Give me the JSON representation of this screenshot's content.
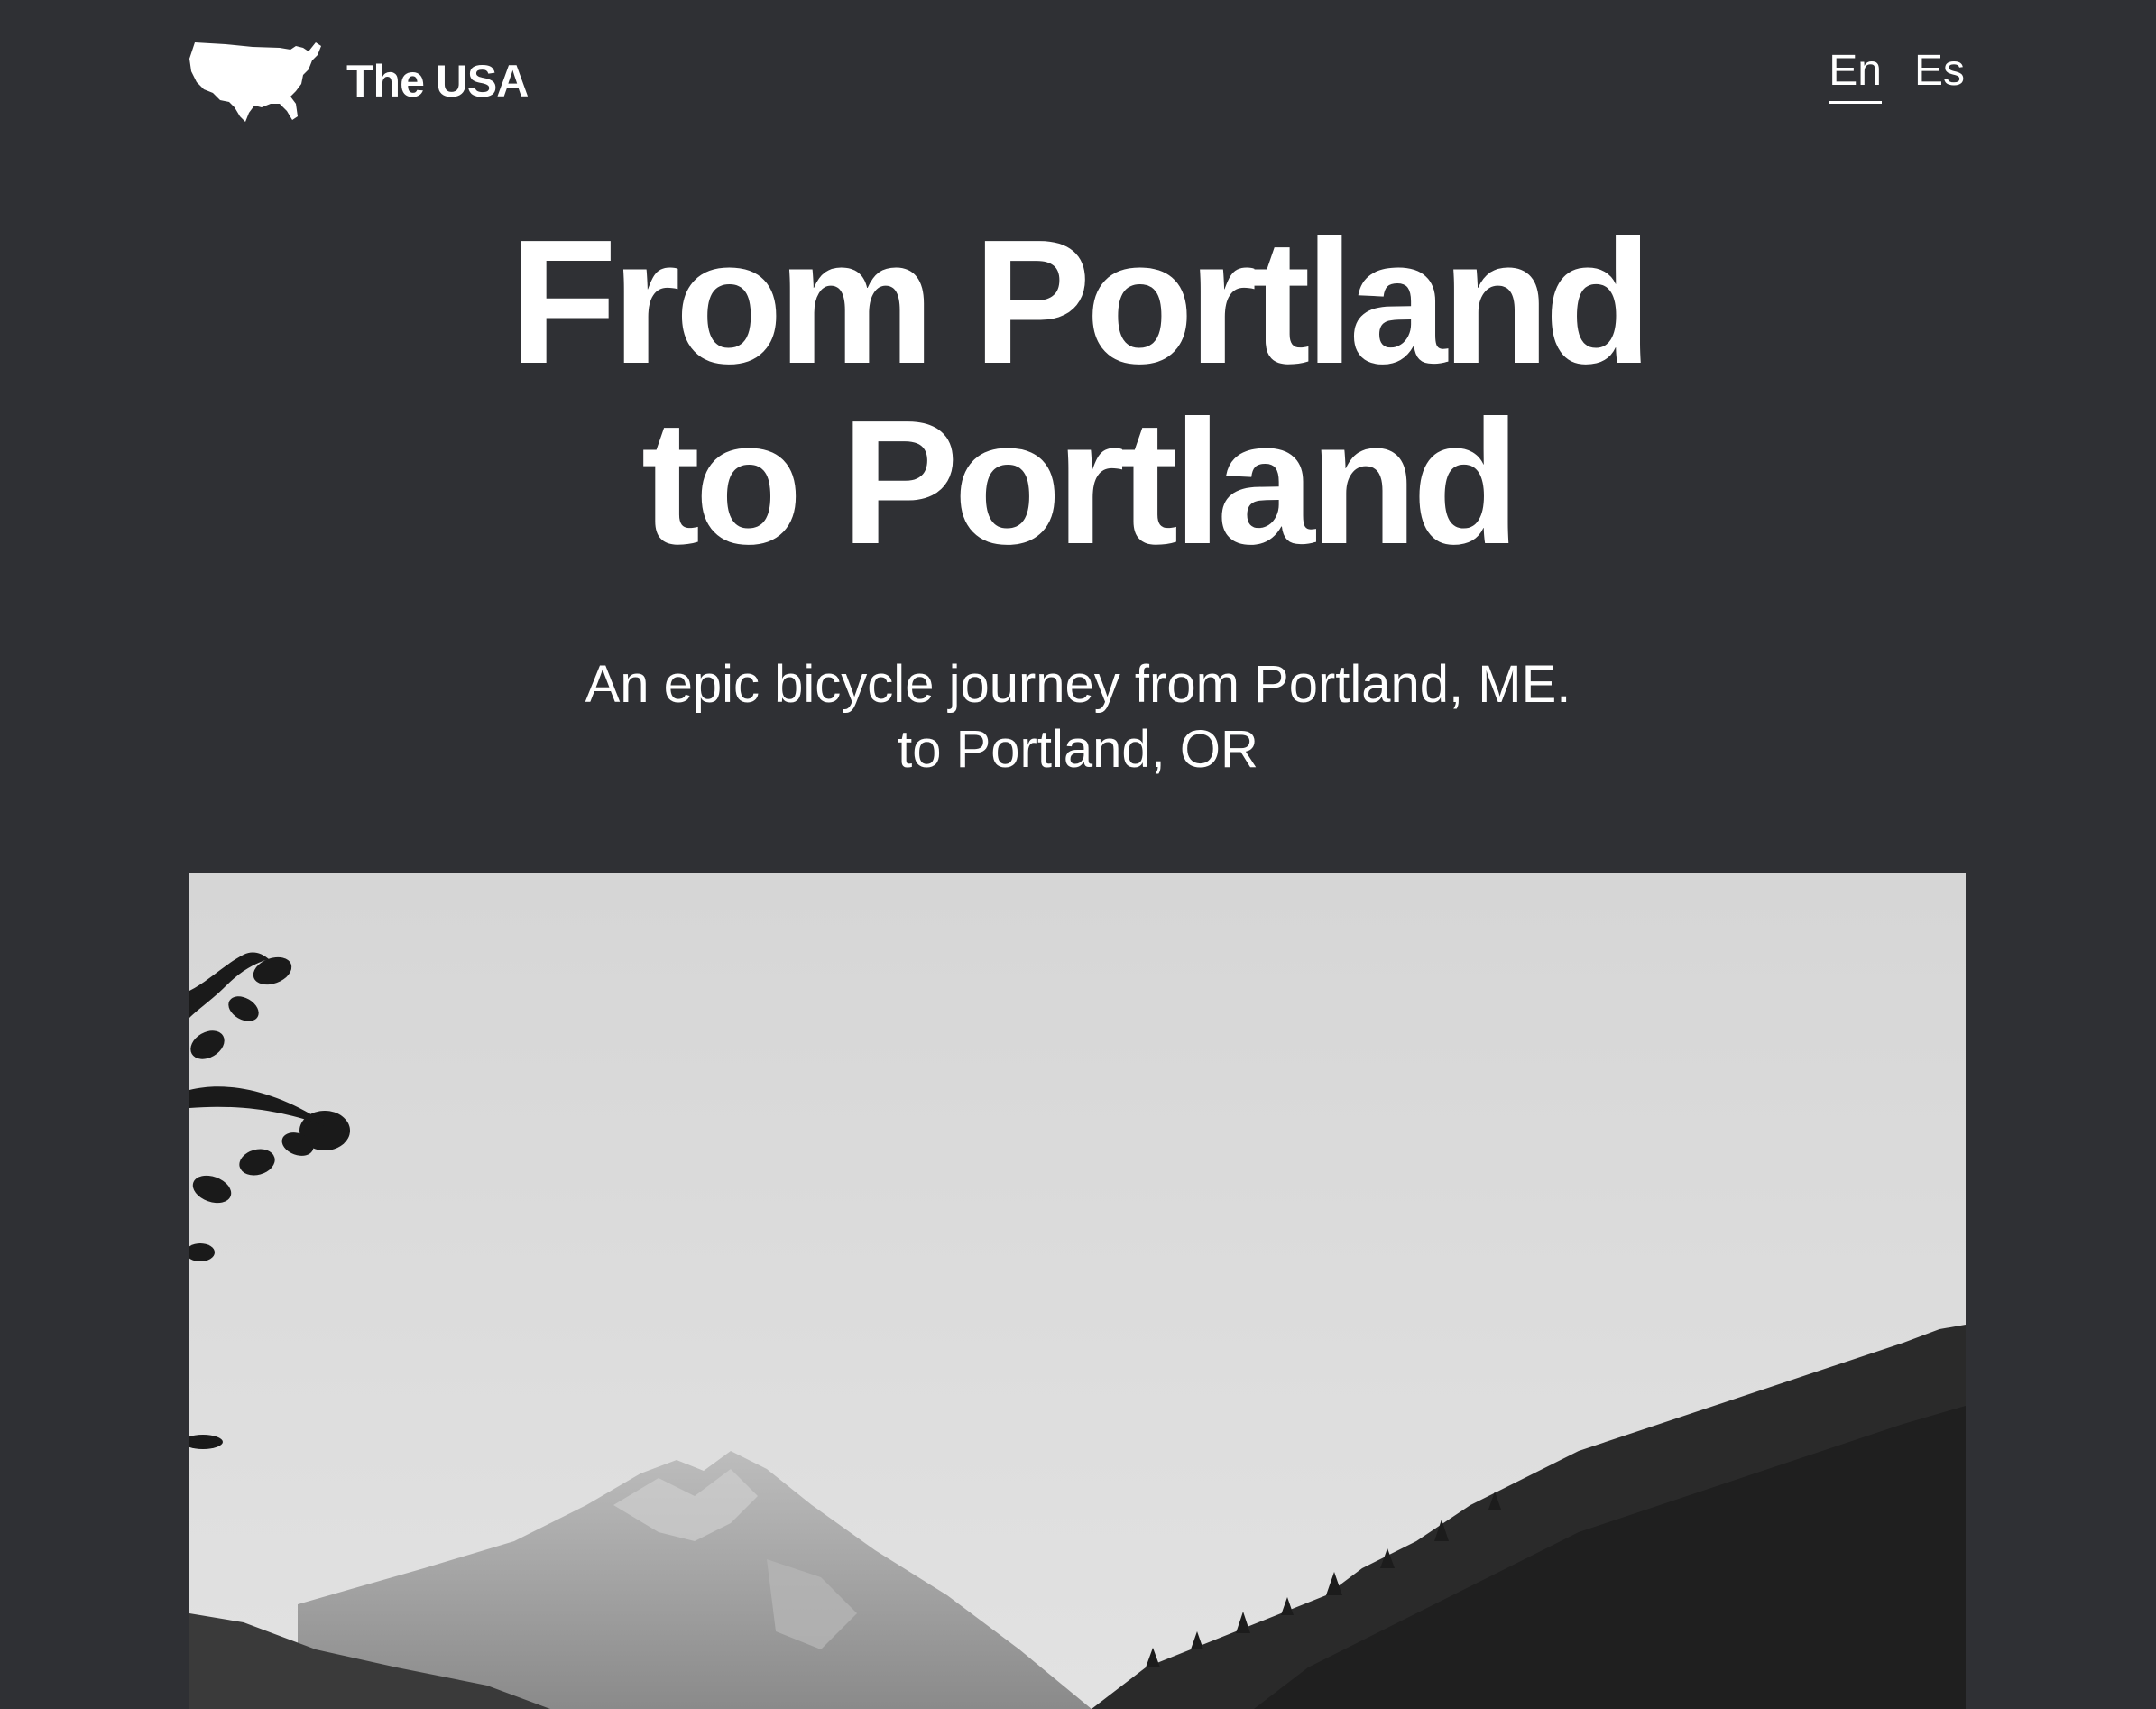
{
  "header": {
    "brand_name": "The USA",
    "languages": [
      {
        "label": "En",
        "active": true
      },
      {
        "label": "Es",
        "active": false
      }
    ]
  },
  "hero": {
    "title_line1": "From Portland",
    "title_line2": "to Portland",
    "subtitle_line1": "An epic bicycle journey from Portland, ME.",
    "subtitle_line2": "to Portland, OR"
  },
  "photo": {
    "icon": "mountain-landscape-photo"
  },
  "colors": {
    "background": "#2f3034",
    "text": "#ffffff"
  }
}
